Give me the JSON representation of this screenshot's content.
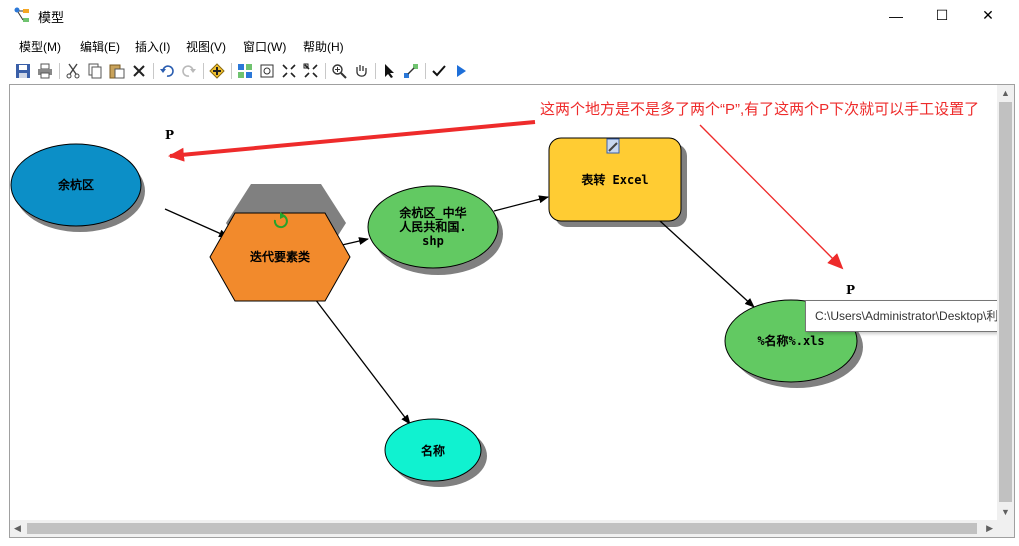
{
  "window": {
    "title": "模型",
    "minimize": "—",
    "maximize": "☐",
    "close": "✕"
  },
  "menu": [
    "模型(M)",
    "编辑(E)",
    "插入(I)",
    "视图(V)",
    "窗口(W)",
    "帮助(H)"
  ],
  "toolbar_icons": [
    "save-icon",
    "print-icon",
    "cut-icon",
    "copy-icon",
    "paste-icon",
    "delete-icon",
    "undo-icon",
    "redo-icon",
    "add-data-icon",
    "auto-layout-icon",
    "full-extent-icon",
    "zoom-in-fixed-icon",
    "zoom-out-fixed-icon",
    "zoom-in-icon",
    "pan-icon",
    "select-icon",
    "connect-icon",
    "validate-icon",
    "run-icon"
  ],
  "model": {
    "nodes": {
      "yuhang": "余杭区",
      "iterate": "迭代要素类",
      "shp_line1": "余杭区_中华",
      "shp_line2": "人民共和国.",
      "shp_line3": "shp",
      "excel": "表转 Excel",
      "name": "名称",
      "xls": "%名称%.xls"
    },
    "parameter_marks": [
      "P",
      "P"
    ],
    "colors": {
      "yuhang": "#0c8fc7",
      "iterate": "#f28a2c",
      "shp": "#62c962",
      "excel": "#ffcc33",
      "name": "#10f2d0",
      "xls": "#62c962",
      "annotation": "#ee2b2b"
    }
  },
  "annotation": "这两个地方是不是多了两个“P”,有了这两个P下次就可以手工设置了",
  "tooltip": "C:\\Users\\Administrator\\Desktop\\利用"
}
